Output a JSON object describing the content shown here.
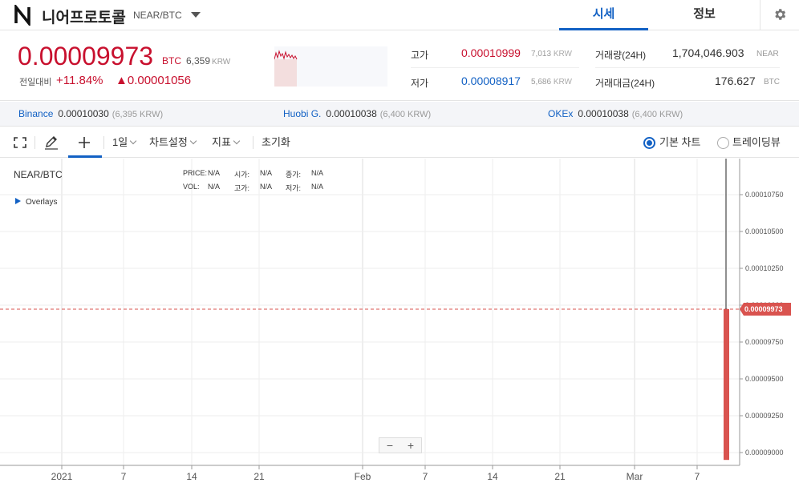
{
  "header": {
    "coin_name": "니어프로토콜",
    "pair": "NEAR/BTC",
    "tabs": [
      {
        "label": "시세",
        "active": true
      },
      {
        "label": "정보",
        "active": false
      }
    ],
    "icons": {
      "logo": "near-logo-icon",
      "dropdown": "caret-down-icon",
      "settings": "gear-icon"
    }
  },
  "price": {
    "current": "0.00009973",
    "unit": "BTC",
    "krw": "6,359",
    "krw_unit": "KRW",
    "change_label": "전일대비",
    "change_pct": "+11.84%",
    "change_abs": "▲0.00001056"
  },
  "stats": {
    "high_label": "고가",
    "high_value": "0.00010999",
    "high_krw": "7,013",
    "low_label": "저가",
    "low_value": "0.00008917",
    "low_krw": "5,686",
    "krw_unit": "KRW",
    "volume_label": "거래량(24H)",
    "volume_value": "1,704,046.903",
    "volume_unit": "NEAR",
    "amount_label": "거래대금(24H)",
    "amount_value": "176.627",
    "amount_unit": "BTC"
  },
  "exchanges": [
    {
      "name": "Binance",
      "price": "0.00010030",
      "krw": "(6,395 KRW)"
    },
    {
      "name": "Huobi G.",
      "price": "0.00010038",
      "krw": "(6,400 KRW)"
    },
    {
      "name": "OKEx",
      "price": "0.00010038",
      "krw": "(6,400 KRW)"
    }
  ],
  "toolbar": {
    "interval": "1일",
    "chart_settings": "차트설정",
    "indicators": "지표",
    "reset": "초기화",
    "basic_chart": "기본 차트",
    "trading_view": "트레이딩뷰",
    "basic_selected": true
  },
  "chart": {
    "title": "NEAR/BTC",
    "legend_row1": [
      {
        "label": "PRICE:",
        "value": "N/A"
      },
      {
        "label": "시가:",
        "value": "N/A"
      },
      {
        "label": "종가:",
        "value": "N/A"
      }
    ],
    "legend_row2": [
      {
        "label": "VOL:",
        "value": "N/A"
      },
      {
        "label": "고가:",
        "value": "N/A"
      },
      {
        "label": "저가:",
        "value": "N/A"
      }
    ],
    "overlays": "Overlays",
    "zoom_out": "−",
    "zoom_in": "+",
    "price_tag": "0.00009973",
    "colors": {
      "up": "#c8102e",
      "accent": "#1261c4",
      "candle": "#d9534f"
    }
  },
  "chart_data": {
    "type": "line",
    "x_tick_labels": [
      "2021",
      "7",
      "14",
      "21",
      "Feb",
      "7",
      "14",
      "21",
      "Mar",
      "7"
    ],
    "y_tick_labels": [
      "0.00010750",
      "0.00010500",
      "0.00010250",
      "0.00010000",
      "0.00009750",
      "0.00009500",
      "0.00009250",
      "0.00009000"
    ],
    "ylim": [
      8.95e-05,
      0.0001085
    ],
    "last_price": 9.973e-05,
    "last_candle": {
      "low": 8.95e-05,
      "high": 0.0001085
    },
    "grid": true
  }
}
